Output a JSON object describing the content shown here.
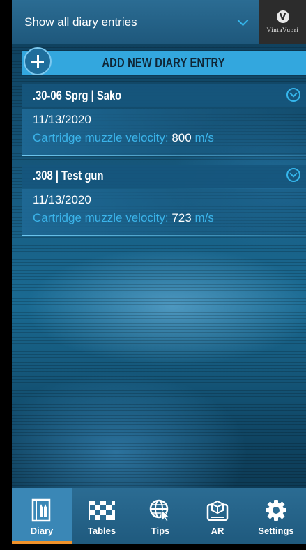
{
  "filter": {
    "label": "Show all diary entries"
  },
  "brand": {
    "mark": "V",
    "name": "VintaVuori"
  },
  "add_entry": {
    "label": "ADD NEW DIARY ENTRY"
  },
  "entries": [
    {
      "title": ".30-06 Sprg | Sako",
      "date": "11/13/2020",
      "velocity_label": "Cartridge muzzle velocity: ",
      "velocity_value": "800",
      "velocity_unit": "m/s"
    },
    {
      "title": ".308 | Test gun",
      "date": "11/13/2020",
      "velocity_label": "Cartridge muzzle velocity: ",
      "velocity_value": "723",
      "velocity_unit": "m/s"
    }
  ],
  "nav": {
    "items": [
      {
        "label": "Diary",
        "icon": "diary-icon",
        "active": true
      },
      {
        "label": "Tables",
        "icon": "tables-icon",
        "active": false
      },
      {
        "label": "Tips",
        "icon": "tips-icon",
        "active": false
      },
      {
        "label": "AR",
        "icon": "ar-icon",
        "active": false
      },
      {
        "label": "Settings",
        "icon": "settings-icon",
        "active": false
      }
    ]
  },
  "colors": {
    "accent": "#33a7de",
    "active_indicator": "#f0922b",
    "bar": "#2b6c93"
  }
}
